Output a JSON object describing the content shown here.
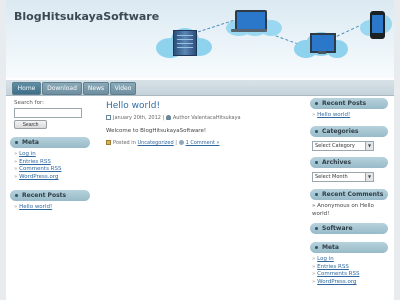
{
  "site": {
    "title": "BlogHitsukayaSoftware"
  },
  "nav": {
    "tabs": [
      "Home",
      "Download",
      "News",
      "Video"
    ]
  },
  "search": {
    "label": "Search for:",
    "button": "Search"
  },
  "left_sidebar": {
    "meta": {
      "title": "Meta",
      "items": [
        "Log in",
        "Entries RSS",
        "Comments RSS",
        "WordPress.org"
      ]
    },
    "recent_posts": {
      "title": "Recent Posts",
      "items": [
        "Hello world!"
      ]
    }
  },
  "post": {
    "title": "Hello world!",
    "date": "January 20th, 2012",
    "author_prefix": "Author",
    "author": "ValentacaHitsukaya",
    "body": "Welcome to BlogHitsukayaSoftware!",
    "posted_in": "Posted in",
    "category": "Uncategorized",
    "separator": "|",
    "comments": "1 Comment »"
  },
  "right_sidebar": {
    "recent_posts": {
      "title": "Recent Posts",
      "items": [
        "Hello world!"
      ]
    },
    "categories": {
      "title": "Categories",
      "select": "Select Category"
    },
    "archives": {
      "title": "Archives",
      "select": "Select Month"
    },
    "recent_comments": {
      "title": "Recent Comments",
      "author": "Anonymous",
      "on": "on",
      "post": "Hello world!"
    },
    "software": {
      "title": "Software"
    },
    "meta": {
      "title": "Meta",
      "items": [
        "Log in",
        "Entries RSS",
        "Comments RSS",
        "WordPress.org"
      ]
    }
  },
  "icons": [
    "server-icon",
    "laptop-icon",
    "monitor-icon",
    "phone-icon",
    "calendar-icon",
    "user-icon",
    "folder-icon",
    "comment-icon"
  ]
}
